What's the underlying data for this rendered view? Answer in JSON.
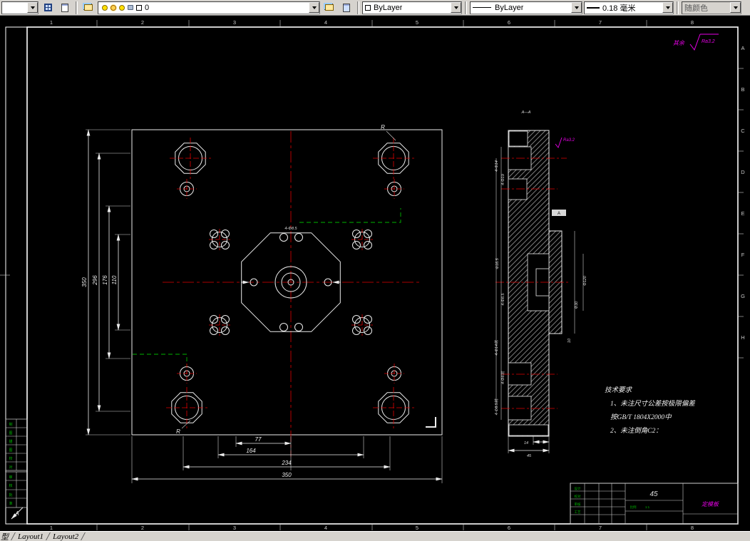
{
  "toolbar": {
    "view_value": "",
    "layer": "0",
    "color": "ByLayer",
    "linetype": "ByLayer",
    "lineweight": "0.18 毫米",
    "plotstyle": "随颜色"
  },
  "tabs": {
    "model": "型",
    "layout1": "Layout1",
    "layout2": "Layout2"
  },
  "sheet": {
    "zones_top": [
      "1",
      "2",
      "3",
      "4",
      "5",
      "6",
      "7",
      "8"
    ],
    "zones_bottom": [
      "1",
      "2",
      "3",
      "4",
      "5",
      "6",
      "7",
      "8"
    ],
    "zones_right": [
      "A",
      "B",
      "C",
      "D",
      "E",
      "F",
      "G",
      "H"
    ],
    "margin_chars": [
      "制",
      "图",
      "描",
      "图",
      "校",
      "对",
      "审",
      "核",
      "批",
      "准"
    ],
    "view_arrow": "A"
  },
  "front_view": {
    "dims_bottom": [
      "77",
      "164",
      "234",
      "350"
    ],
    "dims_left": [
      "350",
      "296",
      "176",
      "110"
    ],
    "center_dim": "4-Φ8.5",
    "radius_label": "R"
  },
  "side_view": {
    "section_label": "A—A",
    "ra_label": "Ra3.2",
    "datum": "A",
    "dims_left": [
      "4-Φ14",
      "4-Φ19",
      "Φ16.5",
      "4-Φ8.5",
      "4-Φ14坑",
      "4-Φ8坑",
      "4-Φ8.5坑"
    ],
    "dims_right": [
      "Φ120",
      "Φ30",
      "10"
    ],
    "dims_bottom": [
      "14",
      "45"
    ]
  },
  "notes": {
    "title": "技术要求",
    "line1": "1、未注尺寸公差按极限偏差",
    "line2": "按GB/T 1804X2000中",
    "line3": "2、未注倒角C2："
  },
  "surface_note": {
    "prefix": "其余",
    "ra": "Ra3.2"
  },
  "title_block": {
    "material": "45",
    "part_name": "定模板",
    "sign_labels": [
      "设计",
      "校对",
      "审核",
      "工艺"
    ],
    "scale_label": "比例",
    "scale_value": "1:1"
  }
}
